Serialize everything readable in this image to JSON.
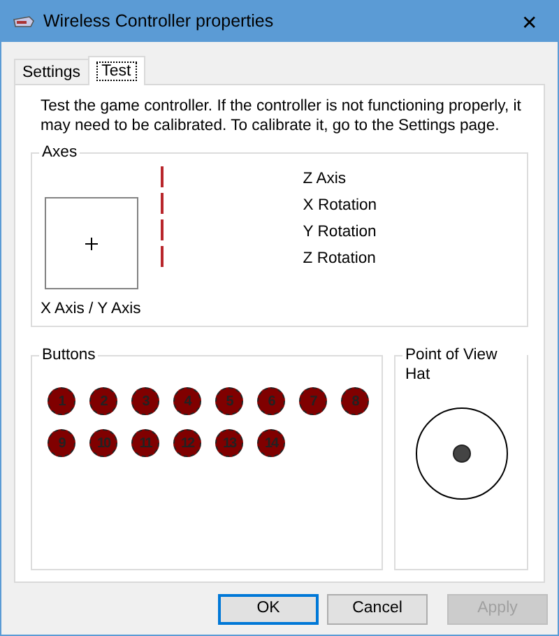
{
  "window": {
    "title": "Wireless Controller properties",
    "close": "✕"
  },
  "tabs": [
    {
      "label": "Settings",
      "selected": false
    },
    {
      "label": "Test",
      "selected": true
    }
  ],
  "description": "Test the game controller.  If the controller is not functioning properly, it may need to be calibrated.  To calibrate it, go to the Settings page.",
  "axes": {
    "title": "Axes",
    "xy_label": "X Axis / Y Axis",
    "axes": [
      "Z Axis",
      "X Rotation",
      "Y Rotation",
      "Z Rotation"
    ]
  },
  "buttons": {
    "title": "Buttons",
    "items": [
      "1",
      "2",
      "3",
      "4",
      "5",
      "6",
      "7",
      "8",
      "9",
      "10",
      "11",
      "12",
      "13",
      "14"
    ]
  },
  "pov_hat": {
    "title": "Point of View Hat"
  },
  "dialog_buttons": [
    {
      "label": "OK",
      "default": true,
      "disabled": false
    },
    {
      "label": "Cancel",
      "default": false,
      "disabled": false
    },
    {
      "label": "Apply",
      "default": false,
      "disabled": true
    }
  ]
}
